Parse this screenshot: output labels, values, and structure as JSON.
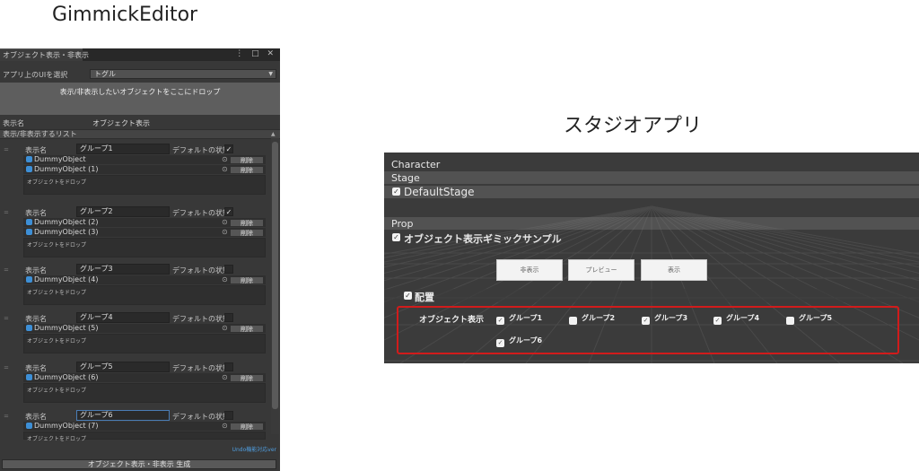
{
  "captions": {
    "left": "GimmickEditor",
    "right": "スタジオアプリ"
  },
  "editor": {
    "tab_title": "オブジェクト表示・非表示",
    "tab_tools": "⋮ □ ✕",
    "select_ui_label": "アプリ上のUIを選択",
    "select_ui_value": "トグル",
    "drop_hint": "表示/非表示したいオブジェクトをここにドロップ",
    "display_name_label": "表示名",
    "display_name_value": "オブジェクト表示",
    "list_header": "表示/非表示するリスト",
    "group_label": "表示名",
    "default_state_label": "デフォルトの状態",
    "delete_label": "削除",
    "drop_object_label": "オブジェクトをドロップ",
    "groups": [
      {
        "name": "グループ1",
        "checked": true,
        "objects": [
          "DummyObject",
          "DummyObject (1)"
        ]
      },
      {
        "name": "グループ2",
        "checked": true,
        "objects": [
          "DummyObject (2)",
          "DummyObject (3)"
        ]
      },
      {
        "name": "グループ3",
        "checked": false,
        "objects": [
          "DummyObject (4)"
        ]
      },
      {
        "name": "グループ4",
        "checked": false,
        "objects": [
          "DummyObject (5)"
        ]
      },
      {
        "name": "グループ5",
        "checked": false,
        "objects": [
          "DummyObject (6)"
        ]
      },
      {
        "name": "グループ6",
        "checked": false,
        "objects": [
          "DummyObject (7)"
        ]
      }
    ],
    "undo_note": "Undo機能対応ver",
    "generate_button": "オブジェクト表示・非表示 生成"
  },
  "studio": {
    "character_label": "Character",
    "stage_label": "Stage",
    "default_stage": "DefaultStage",
    "prop_label": "Prop",
    "gimmick_title": "オブジェクト表示ギミックサンプル",
    "buttons": {
      "hide": "非表示",
      "preview": "プレビュー",
      "show": "表示"
    },
    "placement_label": "配置",
    "object_display_label": "オブジェクト表示",
    "toggle_groups": [
      {
        "name": "グループ1",
        "checked": true
      },
      {
        "name": "グループ2",
        "checked": false
      },
      {
        "name": "グループ3",
        "checked": true
      },
      {
        "name": "グループ4",
        "checked": true
      },
      {
        "name": "グループ5",
        "checked": false
      },
      {
        "name": "グループ6",
        "checked": true
      }
    ]
  },
  "colors": {
    "editor_bg": "#383838",
    "studio_bg": "#3b3b3b",
    "highlight_border": "#d11b1b",
    "object_icon": "#3d8fd6"
  },
  "icons": {
    "object_icon": "cube-icon",
    "target_icon": "target-icon",
    "check_icon": "checkmark-icon",
    "drag_handle": "drag-handle-icon"
  }
}
